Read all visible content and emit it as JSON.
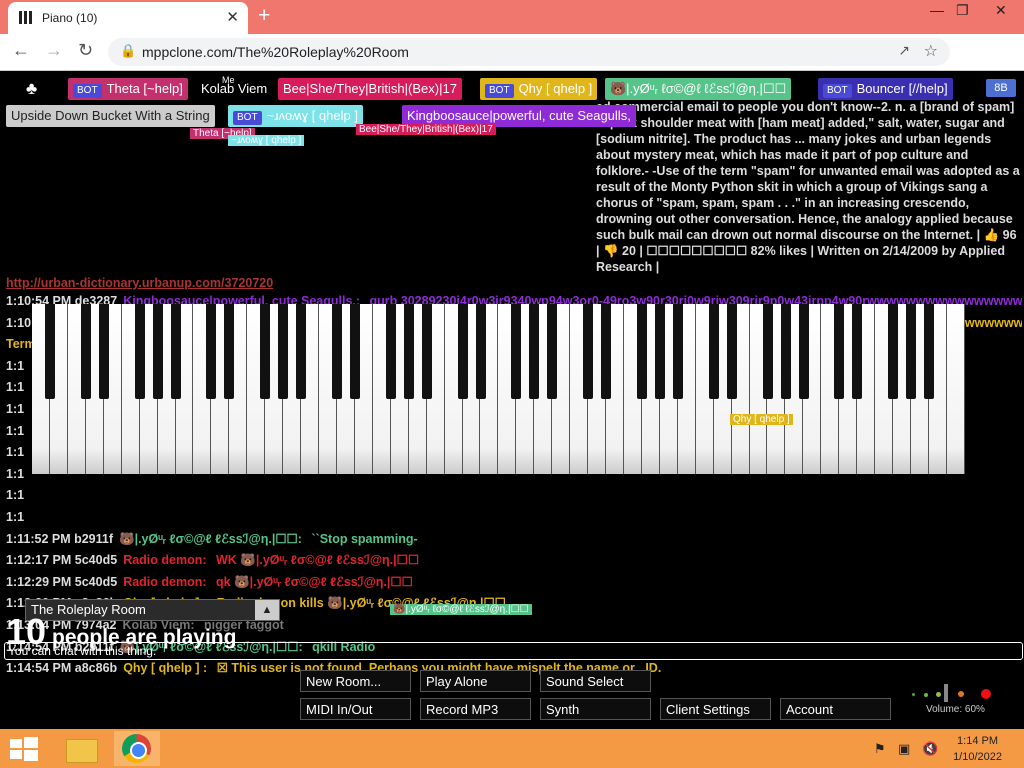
{
  "browser": {
    "tab_title": "Piano (10)",
    "url": "mppclone.com/The%20Roleplay%20Room",
    "new_tab_label": "+",
    "tab_close": "✕"
  },
  "users_top": [
    {
      "name": "Theta [~help]",
      "bot": true,
      "color": "#c2306e"
    },
    {
      "name": "Kolab Viem",
      "bot": false,
      "color": "#000000"
    },
    {
      "name": "Bee|She/They|British|(Bex)|17",
      "bot": false,
      "color": "#d61c5a"
    },
    {
      "name": "Qhy [ qhelp ]",
      "bot": true,
      "color": "#e1b61a"
    },
    {
      "name": "🐻|.уØᵘᵣ ℓσ©@ℓ ℓℰѕѕℐ@η.|☐☐",
      "bot": false,
      "color": "#56c48a"
    },
    {
      "name": "Bouncer [//help]",
      "bot": true,
      "color": "#3a2fb0"
    }
  ],
  "users_second": [
    {
      "name": "Upside Down Bucket With a String",
      "bot": false,
      "color": "#cccccc"
    },
    {
      "name": "~ɹʌoʍɣ [ qhelp ]",
      "bot": true,
      "color": "#7de3e8"
    },
    {
      "name": "Kingboosauce|powerful, cute Seagulls,",
      "bot": false,
      "color": "#8e2bd6"
    }
  ],
  "me_label": "Me",
  "sb_button": "8B",
  "definition_text": "ed commercial email to people you don't know--2. n. a [brand of spam] ... pork shoulder meat with [ham meat] added,\" salt, water, sugar and [sodium nitrite]. The product has ... many jokes and urban legends about mystery meat, which has made it part of pop culture and folklore.- -Use of the term \"spam\" for unwanted email was adopted as a result of the Monty Python skit in which a group of Vikings sang a chorus of \"spam, spam, spam . . .\" in an increasing crescendo, drowning out other conversation. Hence, the analogy applied because such bulk mail can drown out normal discourse on the Internet. | 👍 96 | 👎 20 | ☐☐☐☐☐☐☐☐☐ 82% likes | Written on 2/14/2009 by Applied Research |",
  "definition_link": "http://urban-dictionary.urbanup.com/3720720",
  "chat": [
    {
      "time": "1:10:54 PM",
      "id": "de3287",
      "name": "Kingboosauce|powerful, cute Seagulls,:",
      "color": "#8e2bd6",
      "msg": "qurb 30289230i4r0w3ir9340wp94w3or0-49ro3w90r30ri0w9riw309rir9p0w43irpp4w90rwwwwwwwwwwwwwwwwwwwwwwwwwwwwwwwwwwwwwwwwwwwwwwww3ru3094ioliloloioloioloioloioloioloioloioloioloioloioloio",
      "msg_color": "#8e2bd6"
    },
    {
      "time": "1:10:55 PM",
      "id": "a8c86b",
      "name": "Qhy [ qhelp ] :",
      "color": "#e1b61a",
      "msg": "30289230i4r0w3ir9340wp94w3or0-49ro3w90r30ri0w9riw309rir9p0w43irpp4w90rwwwwwwwwwwwwwwwwwwwwwwwwwwwwwwwwwwwwwwwwww3ru3094ioliloloioloioloioloioloioloioloioloioloio",
      "msg_color": "#e1b61a"
    },
    {
      "time": "",
      "id": "",
      "name": "",
      "color": "#e1b61a",
      "msg": "Term not found.",
      "msg_color": "#e1b61a"
    },
    {
      "time": "1:11:52 PM",
      "id": "b2911f",
      "name": "🐻|.уØᵘᵣ ℓσ©@ℓ ℓℰѕѕℐ@η.|☐☐:",
      "color": "#56c48a",
      "msg": "``Stop spamming-",
      "msg_color": "#56c48a"
    },
    {
      "time": "1:12:17 PM",
      "id": "5c40d5",
      "name": "Radio demon:",
      "color": "#e0242f",
      "msg": "WK 🐻|.уØᵘᵣ ℓσ©@ℓ ℓℰѕѕℐ@η.|☐☐",
      "msg_color": "#e0242f"
    },
    {
      "time": "1:12:29 PM",
      "id": "5c40d5",
      "name": "Radio demon:",
      "color": "#e0242f",
      "msg": "qk 🐻|.уØᵘᵣ ℓσ©@ℓ ℓℰѕѕℐ@η.|☐☐",
      "msg_color": "#e0242f"
    },
    {
      "time": "1:12:30 PM",
      "id": "a8c86b",
      "name": "Qhy [ qhelp ] :",
      "color": "#e1b61a",
      "msg": "Radio demon kills 🐻|.уØᵘᵣ ℓσ©@ℓ ℓℰѕѕℐ@η.|☐☐",
      "msg_color": "#e1b61a"
    },
    {
      "time": "1:13:04 PM",
      "id": "7974a2",
      "name": "Kolab Viem:",
      "color": "#777777",
      "msg": "nigger faggot",
      "msg_color": "#777777"
    },
    {
      "time": "1:14:54 PM",
      "id": "b2911f",
      "name": "🐻|.уØᵘᵣ ℓσ©@ℓ ℓℰѕѕℐ@η.|☐☐:",
      "color": "#56c48a",
      "msg": "qkill Radio",
      "msg_color": "#56c48a"
    },
    {
      "time": "1:14:54 PM",
      "id": "a8c86b",
      "name": "Qhy [ qhelp ] :",
      "color": "#e1b61a",
      "msg": "☒ This user is not found. Perhaps you might have mispelt the name or _ID.",
      "msg_color": "#e1b61a"
    }
  ],
  "hidden_times": [
    "1:1",
    "1:1",
    "1:1",
    "1:1",
    "1:1",
    "1:1",
    "1:1",
    "1:1"
  ],
  "key_labels": [
    "Qhy [ qhelp ]"
  ],
  "cursor_labels": [
    {
      "text": "Theta [~help]",
      "color": "#c2306e"
    },
    {
      "text": "~ɹʌoʍɣ [ qhelp ]",
      "color": "#7de3e8"
    },
    {
      "text": "Bee|She/They|British|(Bex)|17",
      "color": "#d61c5a"
    },
    {
      "text": "Qhy [ qhelp ]",
      "color": "#e1b61a"
    },
    {
      "text": "🐻|.уØᵘᵣ ℓσ©@ℓ ℓℰѕѕℐ@η.|☐☐",
      "color": "#56c48a"
    }
  ],
  "chat_input_placeholder": "You can chat with this thing.",
  "room": "The Roleplay Room",
  "people_count": "10",
  "people_text": "people are playing",
  "buttons_row1": [
    "New Room...",
    "Play Alone",
    "Sound Select"
  ],
  "buttons_row2": [
    "MIDI In/Out",
    "Record MP3",
    "Synth",
    "Client Settings",
    "Account"
  ],
  "volume": "Volume: 60%",
  "volume_fraction": 0.6,
  "clock": {
    "time": "1:14 PM",
    "date": "1/10/2022"
  }
}
